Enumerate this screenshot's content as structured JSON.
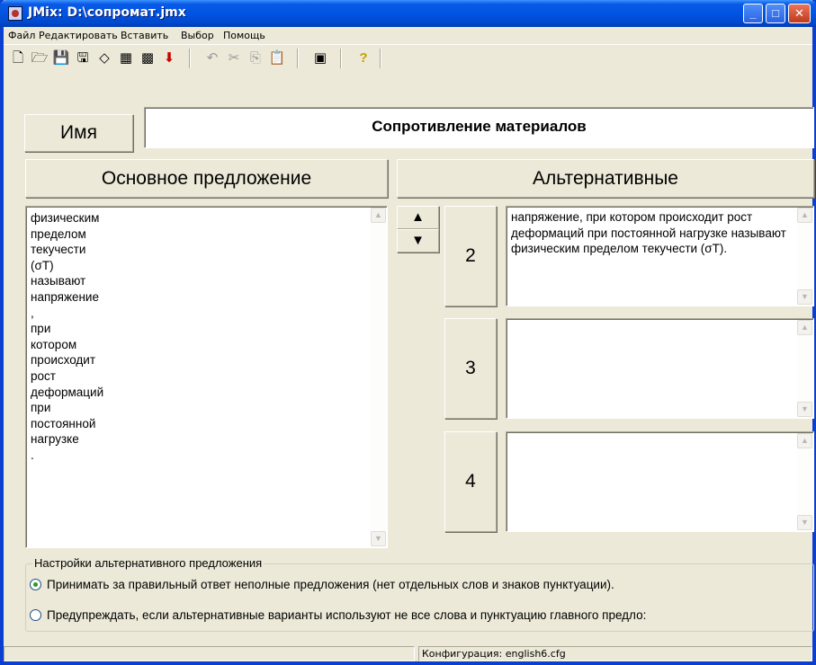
{
  "window": {
    "title": "JMix: D:\\сопромат.jmx"
  },
  "menu": [
    "Файл",
    "Редактировать",
    "Вставить",
    "Выбор",
    "Помощь"
  ],
  "toolbar": {
    "icons": [
      "new-file-icon",
      "open-folder-icon",
      "save-icon",
      "save-as-icon",
      "eraser-icon",
      "export-web-icon",
      "export-web-alt-icon",
      "insert-arrow-icon",
      "undo-icon",
      "cut-icon",
      "copy-icon",
      "paste-icon",
      "settings-icon",
      "help-icon"
    ]
  },
  "name": {
    "label": "Имя",
    "value": "Сопротивление материалов"
  },
  "main": {
    "heading": "Основное предложение",
    "words": [
      "физическим",
      "пределом",
      "текучести",
      "(σT)",
      "называют",
      "напряжение",
      ",",
      "при",
      "котором",
      "происходит",
      "рост",
      "деформаций",
      "при",
      "постоянной",
      "нагрузке",
      "."
    ]
  },
  "alternatives": {
    "heading": "Альтернативные",
    "items": [
      {
        "number": "2",
        "text": "напряжение, при котором происходит рост деформаций при постоянной нагрузке называют физическим пределом текучести (σT)."
      },
      {
        "number": "3",
        "text": ""
      },
      {
        "number": "4",
        "text": ""
      }
    ]
  },
  "options": {
    "title": "Настройки альтернативного предложения",
    "radios": [
      {
        "label": "Принимать за правильный ответ неполные предложения (нет отдельных слов и знаков пунктуации).",
        "checked": true
      },
      {
        "label": "Предупреждать, если альтернативные варианты используют не все слова и пунктуацию главного предло:",
        "checked": false
      }
    ]
  },
  "status": {
    "config": "Конфигурация: english6.cfg"
  }
}
